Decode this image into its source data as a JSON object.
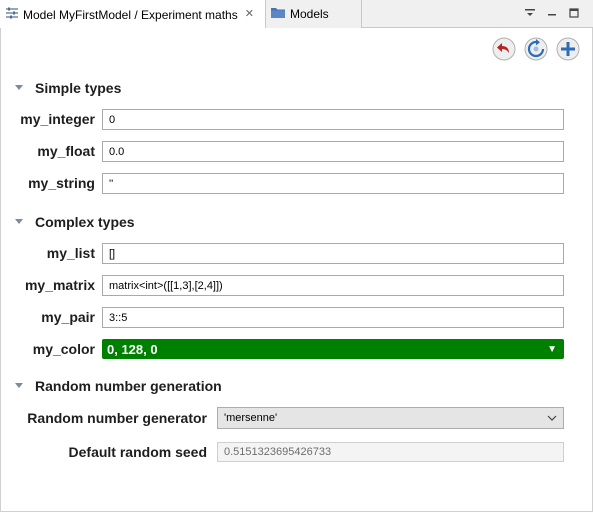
{
  "tabs": [
    {
      "label": "Model MyFirstModel / Experiment maths",
      "icon": "experiment-icon"
    },
    {
      "label": "Models",
      "icon": "folder-icon"
    }
  ],
  "toolbar": {
    "revert_icon": "revert-icon",
    "refresh_icon": "refresh-icon",
    "add_icon": "add-icon"
  },
  "sections": {
    "simple": "Simple types",
    "complex": "Complex types",
    "random": "Random number generation"
  },
  "simple": [
    {
      "label": "my_integer",
      "value": "0"
    },
    {
      "label": "my_float",
      "value": "0.0"
    },
    {
      "label": "my_string",
      "value": "''"
    }
  ],
  "complex": [
    {
      "label": "my_list",
      "value": "[]"
    },
    {
      "label": "my_matrix",
      "value": "matrix<int>([[1,3],[2,4]])"
    },
    {
      "label": "my_pair",
      "value": "3::5"
    }
  ],
  "color": {
    "label": "my_color",
    "value": "0, 128, 0",
    "hex": "#008000"
  },
  "random": {
    "generator_label": "Random number generator",
    "generator_value": "'mersenne'",
    "seed_label": "Default random seed",
    "seed_value": "0.5151323695426733"
  }
}
